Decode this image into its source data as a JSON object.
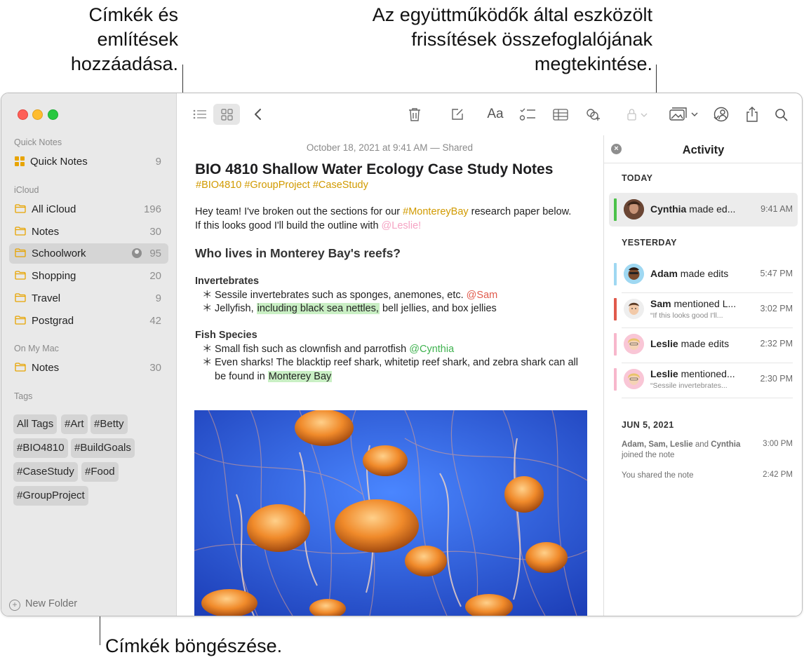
{
  "callouts": {
    "tags_mentions": [
      "Címkék és",
      "említések",
      "hozzáadása."
    ],
    "activity_summary": [
      "Az együttműködők által eszközölt",
      "frissítések összefoglalójának",
      "megtekintése."
    ],
    "browse_tags": "Címkék böngészése."
  },
  "sidebar": {
    "quick_notes_header": "Quick Notes",
    "quick_notes": {
      "label": "Quick Notes",
      "count": "9"
    },
    "icloud_header": "iCloud",
    "icloud_folders": [
      {
        "label": "All iCloud",
        "count": "196"
      },
      {
        "label": "Notes",
        "count": "30"
      },
      {
        "label": "Schoolwork",
        "count": "95",
        "selected": true,
        "shared": true
      },
      {
        "label": "Shopping",
        "count": "20"
      },
      {
        "label": "Travel",
        "count": "9"
      },
      {
        "label": "Postgrad",
        "count": "42"
      }
    ],
    "mac_header": "On My Mac",
    "mac_folders": [
      {
        "label": "Notes",
        "count": "30"
      }
    ],
    "tags_header": "Tags",
    "tags": [
      "All Tags",
      "#Art",
      "#Betty",
      "#BIO4810",
      "#BuildGoals",
      "#CaseStudy",
      "#Food",
      "#GroupProject"
    ],
    "new_folder": "New Folder"
  },
  "toolbar": {
    "icons": [
      "list-view-icon",
      "gallery-view-icon",
      "back-icon",
      "trash-icon",
      "compose-icon",
      "format-icon",
      "checklist-icon",
      "table-icon",
      "link-icon",
      "lock-icon",
      "media-icon",
      "collaborate-icon",
      "share-icon",
      "search-icon"
    ],
    "format_label": "Aa"
  },
  "note": {
    "date": "October 18, 2021 at 9:41 AM — Shared",
    "title": "BIO 4810 Shallow Water Ecology Case Study Notes",
    "tags_line": "#BIO4810 #GroupProject #CaseStudy",
    "intro": {
      "part1": "Hey team! I've broken out the sections for our ",
      "hashtag": "#MontereyBay",
      "part2": " research paper below. If this looks good I'll build the outline with ",
      "mention": "@Leslie!"
    },
    "heading": "Who lives in Monterey Bay's reefs?",
    "invertebrates": {
      "title": "Invertebrates",
      "b1_text": "Sessile invertebrates such as sponges, anemones, etc. ",
      "b1_mention": "@Sam",
      "b2_pre": "Jellyfish, ",
      "b2_hl": "including black sea nettles,",
      "b2_post": " bell jellies, and box jellies"
    },
    "fish": {
      "title": "Fish Species",
      "b1_text": "Small fish such as clownfish and parrotfish ",
      "b1_mention": "@Cynthia",
      "b2_text": "Even sharks! The blacktip reef shark, whitetip reef shark, and zebra shark can all be found in ",
      "b2_hl": "Monterey Bay"
    },
    "bullet_char": "＊"
  },
  "activity": {
    "title": "Activity",
    "close_glyph": "×",
    "today_label": "TODAY",
    "yesterday_label": "YESTERDAY",
    "today": [
      {
        "name": "Cynthia",
        "action": " made ed...",
        "time": "9:41 AM",
        "color": "#4cc24a"
      }
    ],
    "yesterday": [
      {
        "name": "Adam",
        "action": " made edits",
        "time": "5:47 PM",
        "color": "#9fd8f2"
      },
      {
        "name": "Sam",
        "action": " mentioned L...",
        "sub": "“If this looks good I'll...",
        "time": "3:02 PM",
        "color": "#e05a4c"
      },
      {
        "name": "Leslie",
        "action": " made edits",
        "time": "2:32 PM",
        "color": "#f7b7cc"
      },
      {
        "name": "Leslie",
        "action": " mentioned...",
        "sub": "“Sessile invertebrates...",
        "time": "2:30 PM",
        "color": "#f7b7cc"
      }
    ],
    "older_label": "JUN 5, 2021",
    "older": [
      {
        "text": "Adam, Sam, Leslie and Cynthia joined the note",
        "bold": "Adam, Sam, Leslie",
        "plain_mid": " and ",
        "bold2": "Cynthia",
        "rest": " joined the note",
        "time": "3:00 PM"
      },
      {
        "text": "You shared the note",
        "time": "2:42 PM"
      }
    ]
  },
  "colors": {
    "accent": "#e8a400",
    "hashtag": "#d19a00",
    "mention_pink": "#f5a3c3",
    "mention_red": "#e05a4c",
    "mention_green": "#3fb24f",
    "highlight": "#c9efc4"
  }
}
